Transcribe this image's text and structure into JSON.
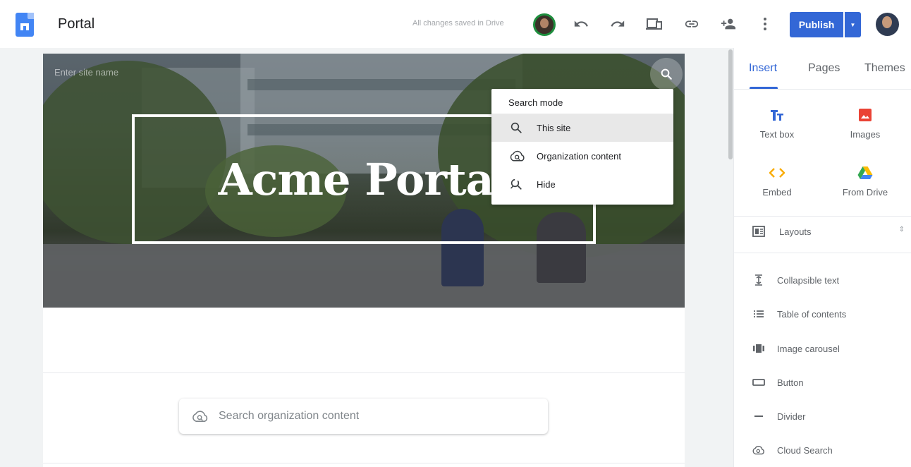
{
  "topbar": {
    "doc_title": "Portal",
    "save_status": "All changes saved in Drive",
    "publish_label": "Publish"
  },
  "hero": {
    "site_name_placeholder": "Enter site name",
    "title": "Acme Portal"
  },
  "search_mode_menu": {
    "header": "Search mode",
    "items": [
      {
        "label": "This site",
        "icon": "search-icon",
        "selected": true
      },
      {
        "label": "Organization content",
        "icon": "cloud-search-icon",
        "selected": false
      },
      {
        "label": "Hide",
        "icon": "search-off-icon",
        "selected": false
      }
    ]
  },
  "org_search": {
    "placeholder": "Search organization content"
  },
  "panel": {
    "tabs": [
      "Insert",
      "Pages",
      "Themes"
    ],
    "active_tab": "Insert",
    "tiles": [
      {
        "label": "Text box",
        "icon": "text-box-icon",
        "color": "#3367d6"
      },
      {
        "label": "Images",
        "icon": "image-icon",
        "color": "#ea4335"
      },
      {
        "label": "Embed",
        "icon": "embed-icon",
        "color": "#f9ab00"
      },
      {
        "label": "From Drive",
        "icon": "drive-icon",
        "color": "#34a853"
      }
    ],
    "layouts_label": "Layouts",
    "components": [
      {
        "label": "Collapsible text",
        "icon": "collapsible-text-icon"
      },
      {
        "label": "Table of contents",
        "icon": "table-of-contents-icon"
      },
      {
        "label": "Image carousel",
        "icon": "image-carousel-icon"
      },
      {
        "label": "Button",
        "icon": "button-icon"
      },
      {
        "label": "Divider",
        "icon": "divider-icon"
      },
      {
        "label": "Cloud Search",
        "icon": "cloud-search-icon"
      }
    ]
  },
  "colors": {
    "accent": "#3367d6",
    "collaborator_ring": "#1e8e3e"
  }
}
